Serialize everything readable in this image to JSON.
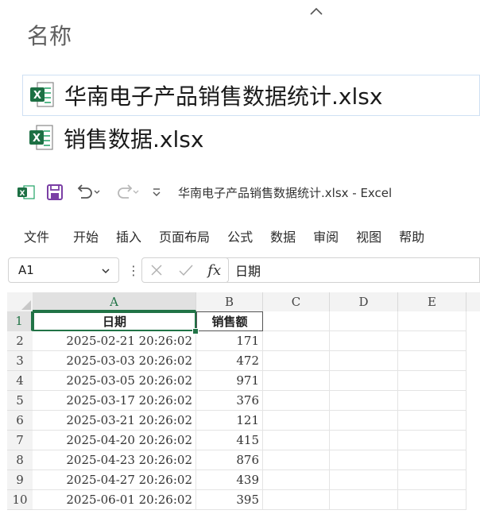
{
  "explorer": {
    "column_header": "名称",
    "files": [
      {
        "name": "华南电子产品销售数据统计.xlsx",
        "selected": true
      },
      {
        "name": "销售数据.xlsx",
        "selected": false
      }
    ]
  },
  "excel": {
    "window_title": "华南电子产品销售数据统计.xlsx  -  Excel",
    "menu": [
      "文件",
      "开始",
      "插入",
      "页面布局",
      "公式",
      "数据",
      "审阅",
      "视图",
      "帮助"
    ],
    "name_box": "A1",
    "formula_value": "日期",
    "columns": [
      "A",
      "B",
      "C",
      "D",
      "E"
    ],
    "header_row": {
      "row": "1",
      "a": "日期",
      "b": "销售额"
    },
    "rows": [
      {
        "row": "2",
        "date": "2025-02-21  20:26:02",
        "amount": "171"
      },
      {
        "row": "3",
        "date": "2025-03-03  20:26:02",
        "amount": "472"
      },
      {
        "row": "4",
        "date": "2025-03-05  20:26:02",
        "amount": "971"
      },
      {
        "row": "5",
        "date": "2025-03-17  20:26:02",
        "amount": "376"
      },
      {
        "row": "6",
        "date": "2025-03-21  20:26:02",
        "amount": "121"
      },
      {
        "row": "7",
        "date": "2025-04-20  20:26:02",
        "amount": "415"
      },
      {
        "row": "8",
        "date": "2025-04-23  20:26:02",
        "amount": "876"
      },
      {
        "row": "9",
        "date": "2025-04-27  20:26:02",
        "amount": "439"
      },
      {
        "row": "10",
        "date": "2025-06-01  20:26:02",
        "amount": "395"
      }
    ],
    "colors": {
      "excel_green": "#217346",
      "save_purple": "#7a3fa5"
    }
  }
}
